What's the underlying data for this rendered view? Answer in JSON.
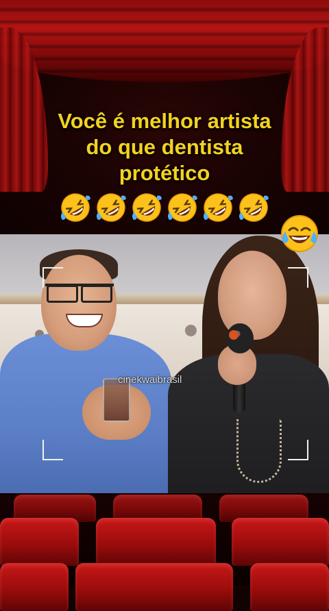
{
  "caption": {
    "lines": [
      "Você é melhor artista",
      "do que dentista",
      "protético"
    ],
    "color": "#f4d21f"
  },
  "emojis": {
    "row_icon": "rolling-on-floor-laughing-emoji",
    "row_count": 6,
    "corner_icon": "face-with-tears-of-joy-emoji"
  },
  "video": {
    "watermark": "cinekwaibrasil"
  },
  "colors": {
    "curtain": "#b31414",
    "seats": "#c81818",
    "background": "#120202"
  }
}
